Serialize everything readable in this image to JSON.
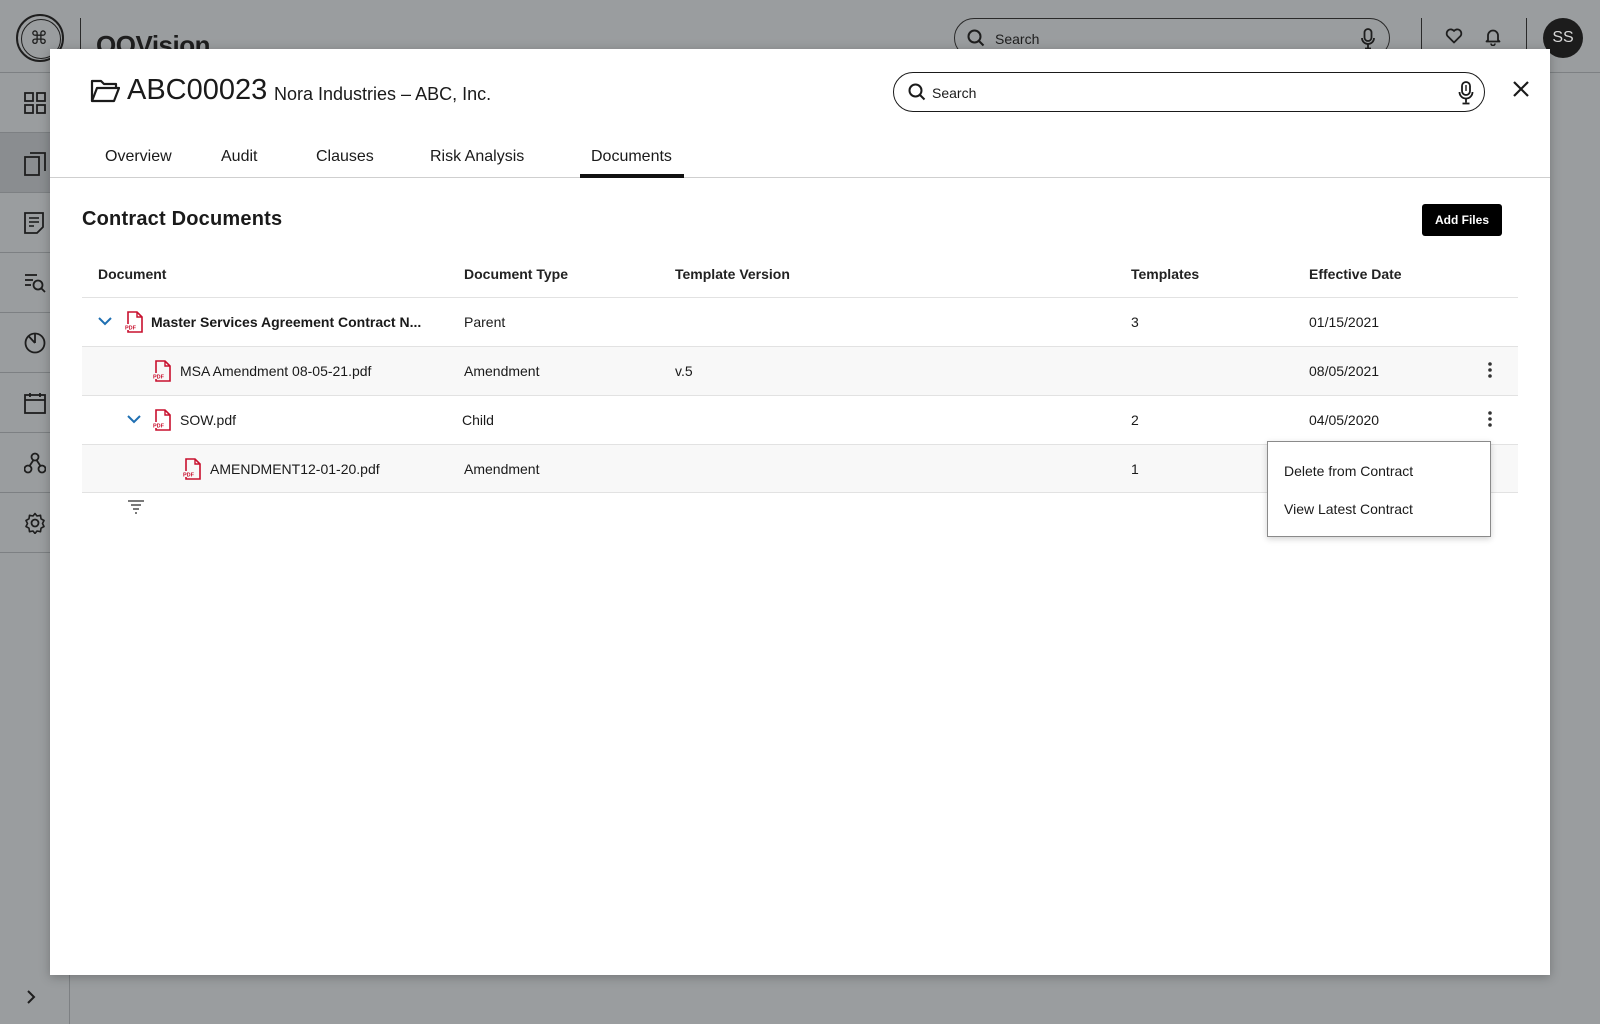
{
  "app": {
    "brand": "OOVision",
    "search_placeholder": "Search",
    "user_initials": "SS"
  },
  "modal": {
    "contract_id": "ABC00023",
    "company": "Nora Industries – ABC, Inc.",
    "search_placeholder": "Search",
    "tabs": [
      {
        "label": "Overview"
      },
      {
        "label": "Audit"
      },
      {
        "label": "Clauses"
      },
      {
        "label": "Risk Analysis"
      },
      {
        "label": "Documents",
        "active": true
      }
    ],
    "section_title": "Contract Documents",
    "add_files_label": "Add Files",
    "table": {
      "headers": [
        "Document",
        "Document Type",
        "Template Version",
        "Templates",
        "Effective Date"
      ],
      "rows": [
        {
          "name": "Master Services Agreement Contract N...",
          "type": "Parent",
          "version": "",
          "templates": "3",
          "date": "01/15/2021"
        },
        {
          "name": "MSA Amendment 08-05-21.pdf",
          "type": "Amendment",
          "version": "v.5",
          "templates": "",
          "date": "08/05/2021"
        },
        {
          "name": "SOW.pdf",
          "type": "Child",
          "version": "",
          "templates": "2",
          "date": "04/05/2020"
        },
        {
          "name": "AMENDMENT12-01-20.pdf",
          "type": "Amendment",
          "version": "",
          "templates": "1",
          "date": ""
        }
      ]
    },
    "context_menu": {
      "items": [
        "Delete from Contract",
        "View Latest Contract"
      ]
    }
  },
  "colors": {
    "accent": "#1f6fb2",
    "pdf_red": "#c8102e",
    "overlay": "#9a9d9f",
    "button_bg": "#000000"
  }
}
